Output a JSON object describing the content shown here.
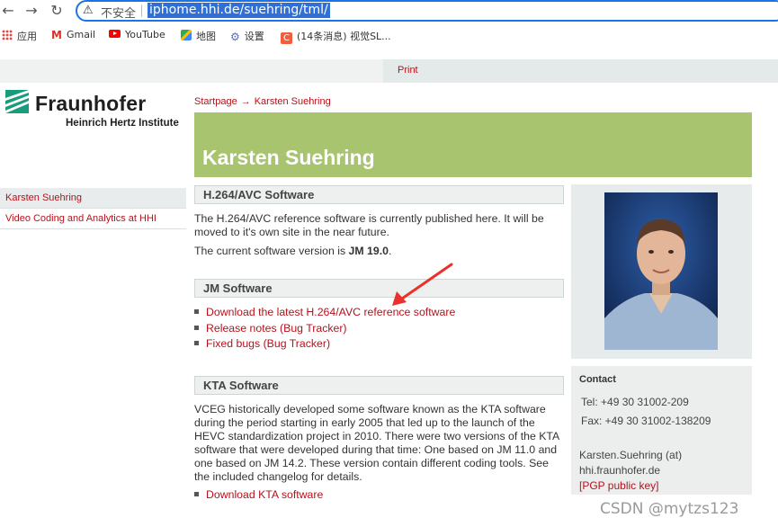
{
  "browser": {
    "security_label": "不安全",
    "url": "iphome.hhi.de/suehring/tml/",
    "bookmarks": [
      {
        "label": "应用",
        "icon": "apps-grid-icon"
      },
      {
        "label": "Gmail",
        "icon": "gmail-icon"
      },
      {
        "label": "YouTube",
        "icon": "youtube-icon"
      },
      {
        "label": "地图",
        "icon": "maps-icon"
      },
      {
        "label": "设置",
        "icon": "gear-icon"
      },
      {
        "label": "(14条消息) 视觉SL...",
        "icon": "csdn-icon"
      }
    ]
  },
  "page": {
    "print_label": "Print",
    "logo": {
      "name": "Fraunhofer",
      "sub": "Heinrich Hertz Institute"
    },
    "breadcrumb": {
      "home": "Startpage",
      "arrow": "→",
      "current": "Karsten Suehring"
    },
    "title": "Karsten Suehring",
    "left_nav": [
      {
        "label": "Karsten Suehring",
        "active": true
      },
      {
        "label": "Video Coding and Analytics at HHI",
        "active": false
      }
    ],
    "sections": {
      "h264": {
        "heading": "H.264/AVC Software",
        "para1": "The H.264/AVC reference software is currently published here. It will be moved to it's own site in the near future.",
        "para2_prefix": "The current software version is ",
        "para2_version": "JM 19.0",
        "para2_suffix": "."
      },
      "jm": {
        "heading": "JM Software",
        "links": [
          "Download the latest H.264/AVC reference software",
          "Release notes (Bug Tracker)",
          "Fixed bugs (Bug Tracker)"
        ]
      },
      "kta": {
        "heading": "KTA Software",
        "para": "VCEG historically developed some software known as the KTA software during the period starting in early 2005 that led up to the launch of the HEVC standardization project in 2010. There were two versions of the KTA software that were developed during that time: One based on JM 11.0 and one based on JM 14.2. These version contain different coding tools. See the included changelog for details.",
        "link": "Download KTA software"
      }
    },
    "contact": {
      "title": "Contact",
      "tel": "Tel:  +49 30 31002-209",
      "fax": "Fax: +49 30 31002-138209",
      "email_line1": "Karsten.Suehring (at)",
      "email_line2": "hhi.fraunhofer.de",
      "pgp": "[PGP public key]"
    }
  },
  "watermark": "CSDN @mytzs123",
  "colors": {
    "link": "#b5121b",
    "banner": "#a8c46e",
    "url_highlight": "#2f6fd6",
    "annotation_arrow": "#e8322b"
  }
}
